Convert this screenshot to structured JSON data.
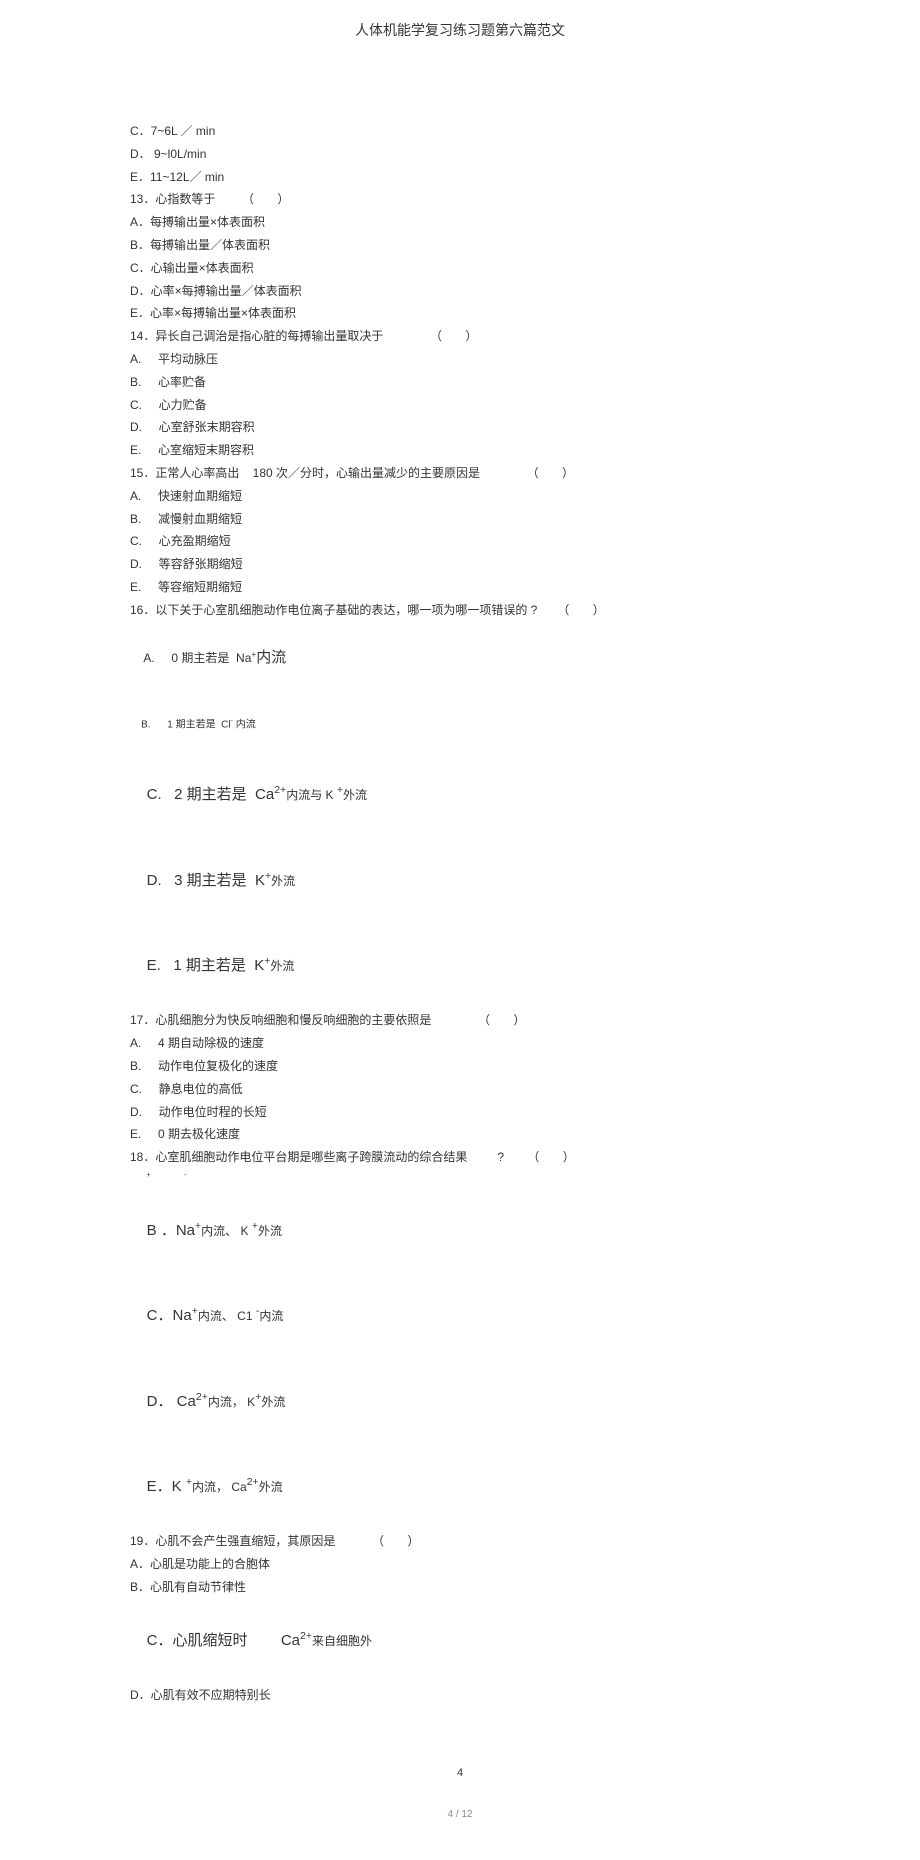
{
  "header": {
    "title": "人体机能学复习练习题第六篇范文"
  },
  "lines": {
    "l01": "C．7~6L ／ min",
    "l02": "D． 9~l0L/min",
    "l03": "E．11~12L／ min",
    "l04": "13．心指数等于        （       ）",
    "l05": "A．每搏输出量×体表面积",
    "l06": "B．每搏输出量／体表面积",
    "l07": "C．心输出量×体表面积",
    "l08": "D．心率×每搏输出量／体表面积",
    "l09": "E．心率×每搏输出量×体表面积",
    "l10": "14．异长自己调治是指心脏的每搏输出量取决于              （       ）",
    "l11": "A.     平均动脉压",
    "l12": "B.     心率贮备",
    "l13": "C.     心力贮备",
    "l14": "D.     心室舒张末期容积",
    "l15": "E.     心室缩短末期容积",
    "l16": "15．正常人心率高出    180 次／分时，心输出量减少的主要原因是              （       ）",
    "l17": "A.     快速射血期缩短",
    "l18": "B.     减慢射血期缩短",
    "l19": "C.     心充盈期缩短",
    "l20": "D.     等容舒张期缩短",
    "l21": "E.     等容缩短期缩短",
    "l22": "16．以下关于心室肌细胞动作电位离子基础的表达，哪一项为哪一项错误的 ?      （       ）",
    "l23a": "A.     0 期主若是  Na",
    "l23b": "内流",
    "l24": "B.      1 期主若是  Cl",
    "l24b": " 内流",
    "l25a": "C.   2 期主若是  Ca",
    "l25b": "内流与 K ",
    "l25c": "外流",
    "l26a": "D.   3 期主若是  K",
    "l26b": "外流",
    "l27a": "E.   1 期主若是  K",
    "l27b": "外流",
    "l28": "17．心肌细胞分为快反响细胞和慢反响细胞的主要依照是              （       ）",
    "l29": "A.     4 期自动除极的速度",
    "l30": "B.     动作电位复极化的速度",
    "l31": "C.     静息电位的高低",
    "l32": "D.     动作电位时程的长短",
    "l33": "E.     0 期去极化速度",
    "l34": "18．心室肌细胞动作电位平台期是哪些离子跨膜流动的综合结果         ?       （       ）",
    "l35a": "B ．Na",
    "l35b": "内流、 K ",
    "l35c": "外流",
    "l36a": "C．Na",
    "l36b": "内流、 C1 ",
    "l36c": "内流",
    "l37a": "D． Ca",
    "l37b": "内流， K",
    "l37c": "外流",
    "l38a": "E．K ",
    "l38b": "内流， Ca",
    "l38c": "外流",
    "l39": "19．心肌不会产生强直缩短，其原因是           （       ）",
    "l40": "A．心肌是功能上的合胞体",
    "l41": "B．心肌有自动节律性",
    "l42a": "C．心肌缩短时        Ca",
    "l42b": "来自细胞外",
    "l43": "D．心肌有效不应期特别长"
  },
  "footer": {
    "num": "4",
    "page": "4 / 12"
  }
}
